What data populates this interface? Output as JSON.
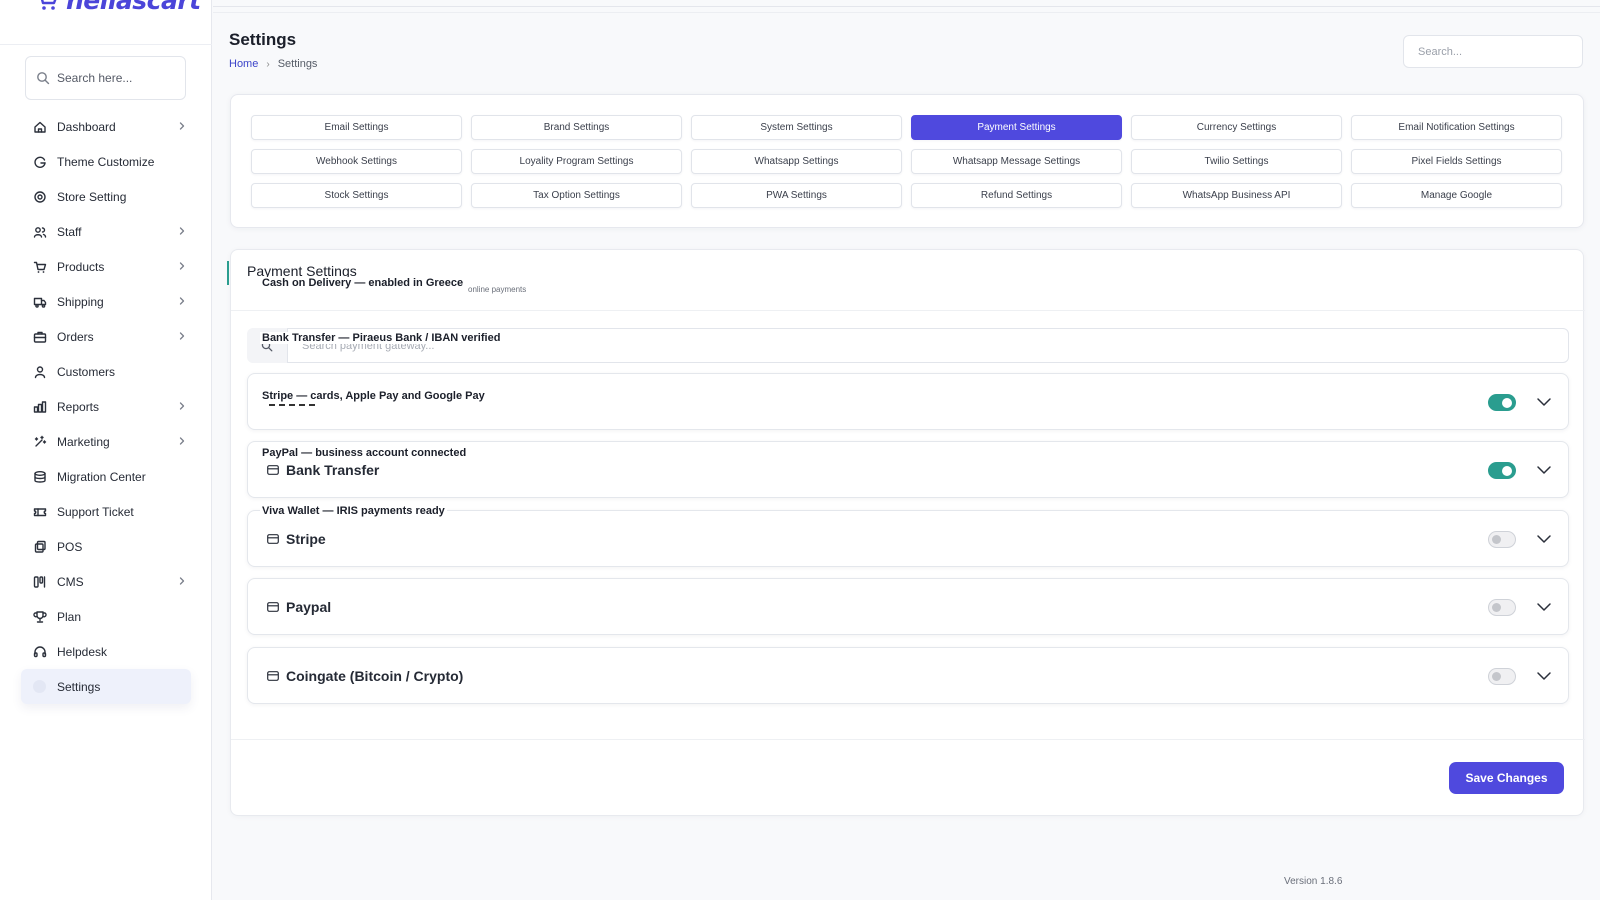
{
  "brand": {
    "logo_text": "hellascart",
    "accent_color": "#4f49de",
    "toggle_on_color": "#2a9d8f"
  },
  "sidebar": {
    "search_placeholder": "Search here...",
    "items": [
      {
        "label": "Dashboard",
        "icon": "home-icon",
        "has_children": true
      },
      {
        "label": "Theme Customize",
        "icon": "theme-icon",
        "has_children": false
      },
      {
        "label": "Store Setting",
        "icon": "settings-gear-icon",
        "has_children": false
      },
      {
        "label": "Staff",
        "icon": "users-icon",
        "has_children": true
      },
      {
        "label": "Products",
        "icon": "cart-icon",
        "has_children": true
      },
      {
        "label": "Shipping",
        "icon": "truck-icon",
        "has_children": true
      },
      {
        "label": "Orders",
        "icon": "briefcase-icon",
        "has_children": true
      },
      {
        "label": "Customers",
        "icon": "user-icon",
        "has_children": false
      },
      {
        "label": "Reports",
        "icon": "bar-chart-icon",
        "has_children": true
      },
      {
        "label": "Marketing",
        "icon": "sparkles-icon",
        "has_children": true
      },
      {
        "label": "Migration Center",
        "icon": "database-icon",
        "has_children": false
      },
      {
        "label": "Support Ticket",
        "icon": "ticket-icon",
        "has_children": false
      },
      {
        "label": "POS",
        "icon": "pos-icon",
        "has_children": false
      },
      {
        "label": "CMS",
        "icon": "layout-icon",
        "has_children": true
      },
      {
        "label": "Plan",
        "icon": "trophy-icon",
        "has_children": false
      },
      {
        "label": "Helpdesk",
        "icon": "headset-icon",
        "has_children": false
      },
      {
        "label": "Settings",
        "icon": "settings-icon",
        "has_children": false,
        "active": true
      }
    ]
  },
  "header": {
    "title": "Settings",
    "breadcrumb_home": "Home",
    "breadcrumb_current": "Settings",
    "search_placeholder": "Search..."
  },
  "tabs": [
    "Email Settings",
    "Brand Settings",
    "System Settings",
    "Payment Settings",
    "Currency Settings",
    "Email Notification Settings",
    "Webhook Settings",
    "Loyality Program Settings",
    "Whatsapp Settings",
    "Whatsapp Message Settings",
    "Twilio Settings",
    "Pixel Fields Settings",
    "Stock Settings",
    "Tax Option Settings",
    "PWA Settings",
    "Refund Settings",
    "WhatsApp Business API",
    "Manage Google"
  ],
  "active_tab": "Payment Settings",
  "payment": {
    "title": "Payment Settings",
    "subtitle_end": "online payments",
    "search_placeholder": "Search payment gateway...",
    "gateways": [
      {
        "name": "",
        "enabled": true
      },
      {
        "name": "Bank Transfer",
        "enabled": true
      },
      {
        "name": "Stripe",
        "enabled": false
      },
      {
        "name": "Paypal",
        "enabled": false
      },
      {
        "name": "Coingate (Bitcoin / Crypto)",
        "enabled": false
      }
    ],
    "save_label": "Save Changes"
  },
  "overlays": [
    "Cash on Delivery — enabled in Greece",
    "Bank Transfer — Piraeus Bank / IBAN verified",
    "Stripe — cards, Apple Pay and Google Pay",
    "PayPal — business account connected",
    "Viva Wallet — IRIS payments ready"
  ],
  "footer": {
    "version": "Version 1.8.6"
  }
}
